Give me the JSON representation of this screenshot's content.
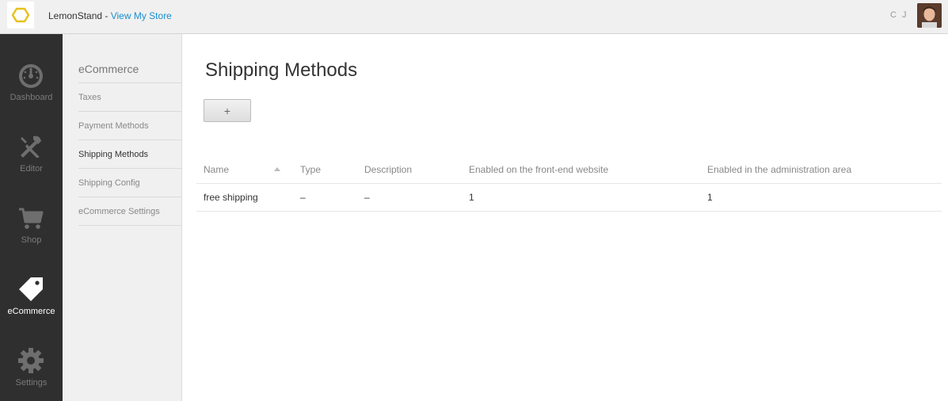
{
  "topbar": {
    "store_name": "LemonStand - ",
    "view_store_link": "View My Store",
    "user_initials": "C J"
  },
  "iconnav": {
    "items": [
      {
        "label": "Dashboard",
        "icon": "gauge-icon",
        "active": false
      },
      {
        "label": "Editor",
        "icon": "tools-icon",
        "active": false
      },
      {
        "label": "Shop",
        "icon": "cart-icon",
        "active": false
      },
      {
        "label": "eCommerce",
        "icon": "tag-icon",
        "active": true
      },
      {
        "label": "Settings",
        "icon": "gear-icon",
        "active": false
      }
    ]
  },
  "subnav": {
    "title": "eCommerce",
    "items": [
      {
        "label": "Taxes",
        "active": false
      },
      {
        "label": "Payment Methods",
        "active": false
      },
      {
        "label": "Shipping Methods",
        "active": true
      },
      {
        "label": "Shipping Config",
        "active": false
      },
      {
        "label": "eCommerce Settings",
        "active": false
      }
    ]
  },
  "main": {
    "title": "Shipping Methods",
    "add_button": "+",
    "columns": [
      "Name",
      "Type",
      "Description",
      "Enabled on the front-end website",
      "Enabled in the administration area"
    ],
    "rows": [
      {
        "name": "free shipping",
        "type": "–",
        "description": "–",
        "frontend": "1",
        "admin": "1"
      }
    ]
  },
  "colors": {
    "accent": "#1a8fd0",
    "logo": "#e8c11c",
    "nav_bg": "#2f2f2f"
  }
}
